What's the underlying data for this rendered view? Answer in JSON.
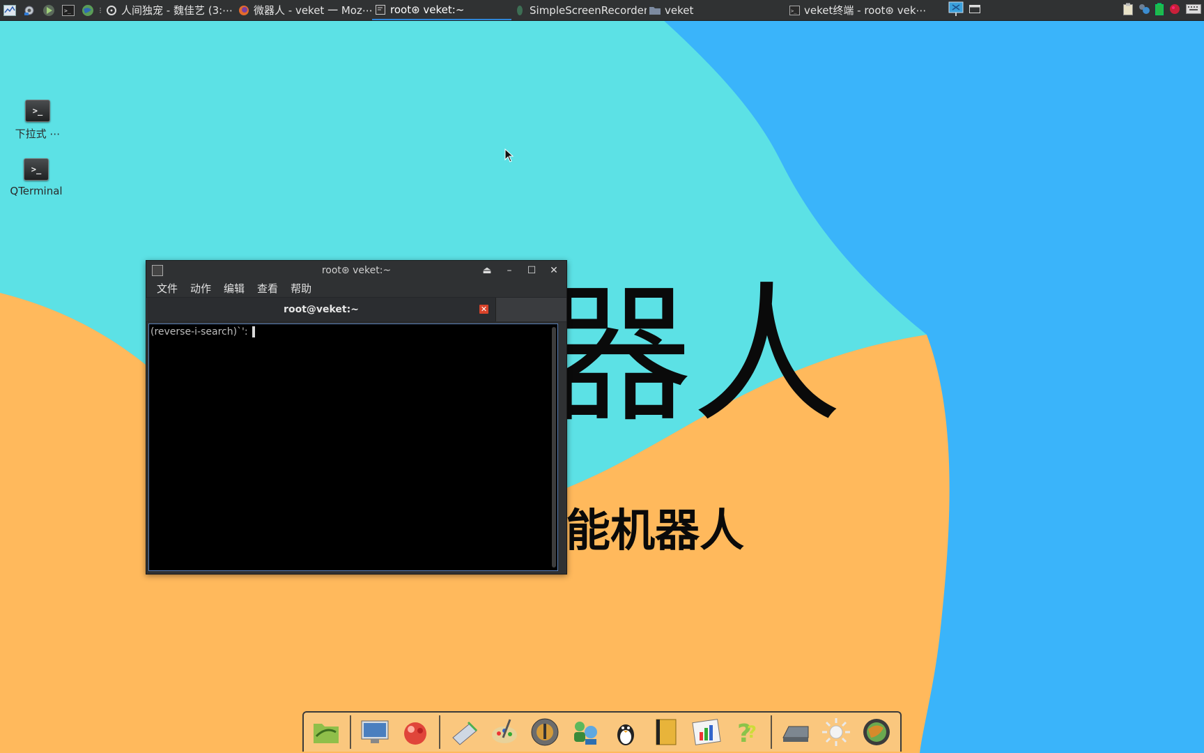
{
  "taskbar": {
    "tasks": [
      {
        "label": "人间独宠 - 魏佳艺 (3:⋯",
        "icon": "media-disc-icon",
        "active": false
      },
      {
        "label": "微器人 - veket 一 Moz⋯",
        "icon": "firefox-icon",
        "active": false
      },
      {
        "label": "root⊛ veket:~",
        "icon": "terminal-icon",
        "active": true
      },
      {
        "label": "SimpleScreenRecorder",
        "icon": "recorder-icon",
        "active": false
      },
      {
        "label": "veket",
        "icon": "folder-icon",
        "active": false
      },
      {
        "label": "veket终端 - root⊛ vek⋯",
        "icon": "terminal-icon",
        "active": false
      }
    ],
    "launchers": [
      "system-monitor-icon",
      "settings-tools-icon",
      "run-icon",
      "terminal-launch-icon",
      "browser-globe-icon"
    ],
    "tray": [
      "network-icon",
      "show-desktop-icon",
      "clipboard-icon",
      "chat-icon",
      "battery-icon",
      "record-icon",
      "keyboard-icon"
    ]
  },
  "desktop": {
    "icons": [
      {
        "label": "下拉式 ⋯",
        "glyph": ">_"
      },
      {
        "label": "QTerminal",
        "glyph": ">_"
      }
    ],
    "wallpaper": {
      "big_text": "器人",
      "sub_text": "能机器人",
      "colors": {
        "cyan": "#5ce1e5",
        "blue": "#3ab4fa",
        "orange": "#ffb95c"
      }
    }
  },
  "terminal": {
    "title": "root⊛ veket:~",
    "menu": [
      "文件",
      "动作",
      "编辑",
      "查看",
      "帮助"
    ],
    "tab_label": "root@veket:~",
    "content_line": "(reverse-i-search)`':"
  },
  "dock": {
    "items": [
      "file-manager-icon",
      "display-settings-icon",
      "package-manager-icon",
      "text-editor-icon",
      "paint-icon",
      "media-player-icon",
      "network-users-icon",
      "qq-penguin-icon",
      "contacts-book-icon",
      "spreadsheet-icon",
      "help-icon",
      "scanner-icon",
      "brightness-icon",
      "web-browser-icon"
    ]
  }
}
